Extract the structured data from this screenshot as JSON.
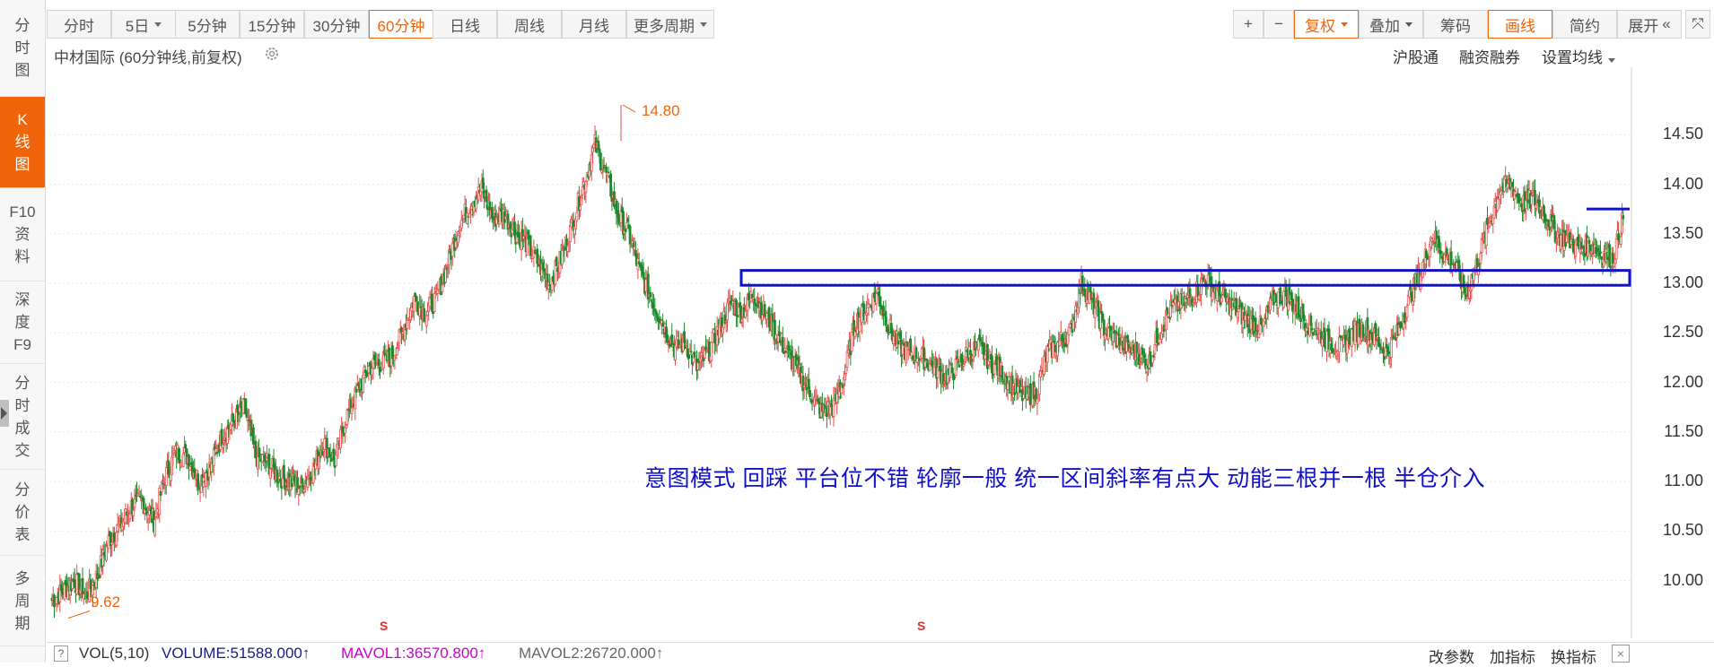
{
  "left_nav": [
    {
      "label": "分时图",
      "chars": [
        "分",
        "时",
        "图"
      ],
      "active": false
    },
    {
      "label": "K线图",
      "chars": [
        "K",
        "线",
        "图"
      ],
      "active": true
    },
    {
      "label": "F10资料",
      "chars": [
        "F10",
        "资",
        "料"
      ],
      "active": false
    },
    {
      "label": "深度F9",
      "chars": [
        "深",
        "度",
        "F9"
      ],
      "active": false
    },
    {
      "label": "分时成交",
      "chars": [
        "分",
        "时",
        "成",
        "交"
      ],
      "active": false
    },
    {
      "label": "分价表",
      "chars": [
        "分",
        "价",
        "表"
      ],
      "active": false
    },
    {
      "label": "多周期",
      "chars": [
        "多",
        "周",
        "期"
      ],
      "active": false
    }
  ],
  "toolbar": {
    "periods": [
      "分时",
      "5日",
      "5分钟",
      "15分钟",
      "30分钟",
      "60分钟",
      "日线",
      "周线",
      "月线",
      "更多周期"
    ],
    "active_period": "60分钟",
    "plus": "+",
    "minus": "−",
    "fuquan": "复权",
    "diejia": "叠加",
    "choumа": "筹码",
    "huaxian": "画线",
    "jianyue": "简约",
    "zhankai": "展开"
  },
  "chart_header": {
    "title": "中材国际 (60分钟线,前复权)",
    "links": [
      "沪股通",
      "融资融券",
      "设置均线"
    ]
  },
  "annotation": "意图模式 回踩 平台位不错 轮廓一般 统一区间斜率有点大 动能三根并一根 半仓介入",
  "bottom": {
    "q": "?",
    "vol": "VOL(5,10)",
    "volume": "VOLUME:51588.000",
    "volume_arrow": "↑",
    "mavol1": "MAVOL1:36570.800",
    "mavol1_arrow": "↑",
    "mavol2": "MAVOL2:26720.000",
    "mavol2_arrow": "↑",
    "buttons": [
      "改参数",
      "加指标",
      "换指标"
    ]
  },
  "colors": {
    "up": "#e84c4c",
    "down": "#1a8a2a",
    "accent": "#f0640a",
    "drawing": "#1010c8",
    "mavol1": "#cc00cc",
    "volume": "#1a1a80"
  },
  "chart_data": {
    "type": "candlestick",
    "title": "中材国际 (60分钟线,前复权)",
    "ylim": [
      9.35,
      15.0
    ],
    "y_ticks": [
      10.0,
      10.5,
      11.0,
      11.5,
      12.0,
      12.5,
      13.0,
      13.5,
      14.0,
      14.5
    ],
    "y_tick_labels": [
      "10.00",
      "10.50",
      "11.00",
      "11.50",
      "12.00",
      "12.50",
      "13.00",
      "13.50",
      "14.00",
      "14.50"
    ],
    "high_label": "14.80",
    "low_label": "9.62",
    "close_path": [
      9.8,
      9.9,
      10.0,
      9.85,
      10.05,
      10.4,
      10.55,
      10.75,
      10.8,
      10.6,
      11.05,
      11.3,
      11.25,
      11.0,
      11.15,
      11.45,
      11.6,
      11.75,
      11.25,
      11.2,
      11.05,
      11.0,
      10.95,
      11.1,
      11.4,
      11.2,
      11.65,
      11.9,
      12.15,
      12.2,
      12.25,
      12.5,
      12.85,
      12.7,
      12.85,
      13.2,
      13.6,
      13.8,
      13.95,
      13.65,
      13.7,
      13.5,
      13.4,
      13.2,
      13.0,
      13.25,
      13.6,
      14.0,
      14.4,
      14.1,
      13.7,
      13.5,
      13.1,
      12.85,
      12.6,
      12.35,
      12.4,
      12.15,
      12.3,
      12.55,
      12.8,
      12.7,
      12.9,
      12.7,
      12.5,
      12.3,
      12.1,
      11.9,
      11.7,
      11.75,
      12.05,
      12.6,
      12.75,
      12.9,
      12.55,
      12.35,
      12.3,
      12.25,
      12.15,
      12.05,
      12.15,
      12.3,
      12.35,
      12.2,
      12.1,
      11.95,
      11.85,
      11.9,
      12.3,
      12.4,
      12.5,
      13.0,
      12.8,
      12.55,
      12.45,
      12.35,
      12.3,
      12.2,
      12.55,
      12.75,
      12.8,
      12.9,
      13.05,
      12.9,
      12.8,
      12.7,
      12.6,
      12.55,
      12.85,
      12.9,
      12.75,
      12.6,
      12.5,
      12.4,
      12.35,
      12.5,
      12.55,
      12.45,
      12.3,
      12.5,
      12.85,
      13.1,
      13.5,
      13.3,
      13.2,
      12.9,
      13.2,
      13.6,
      13.95,
      14.0,
      13.8,
      13.85,
      13.7,
      13.5,
      13.45,
      13.35,
      13.4,
      13.3,
      13.25,
      13.7
    ],
    "horizontal_band": [
      12.98,
      13.13
    ],
    "horizontal_line": 13.75
  }
}
